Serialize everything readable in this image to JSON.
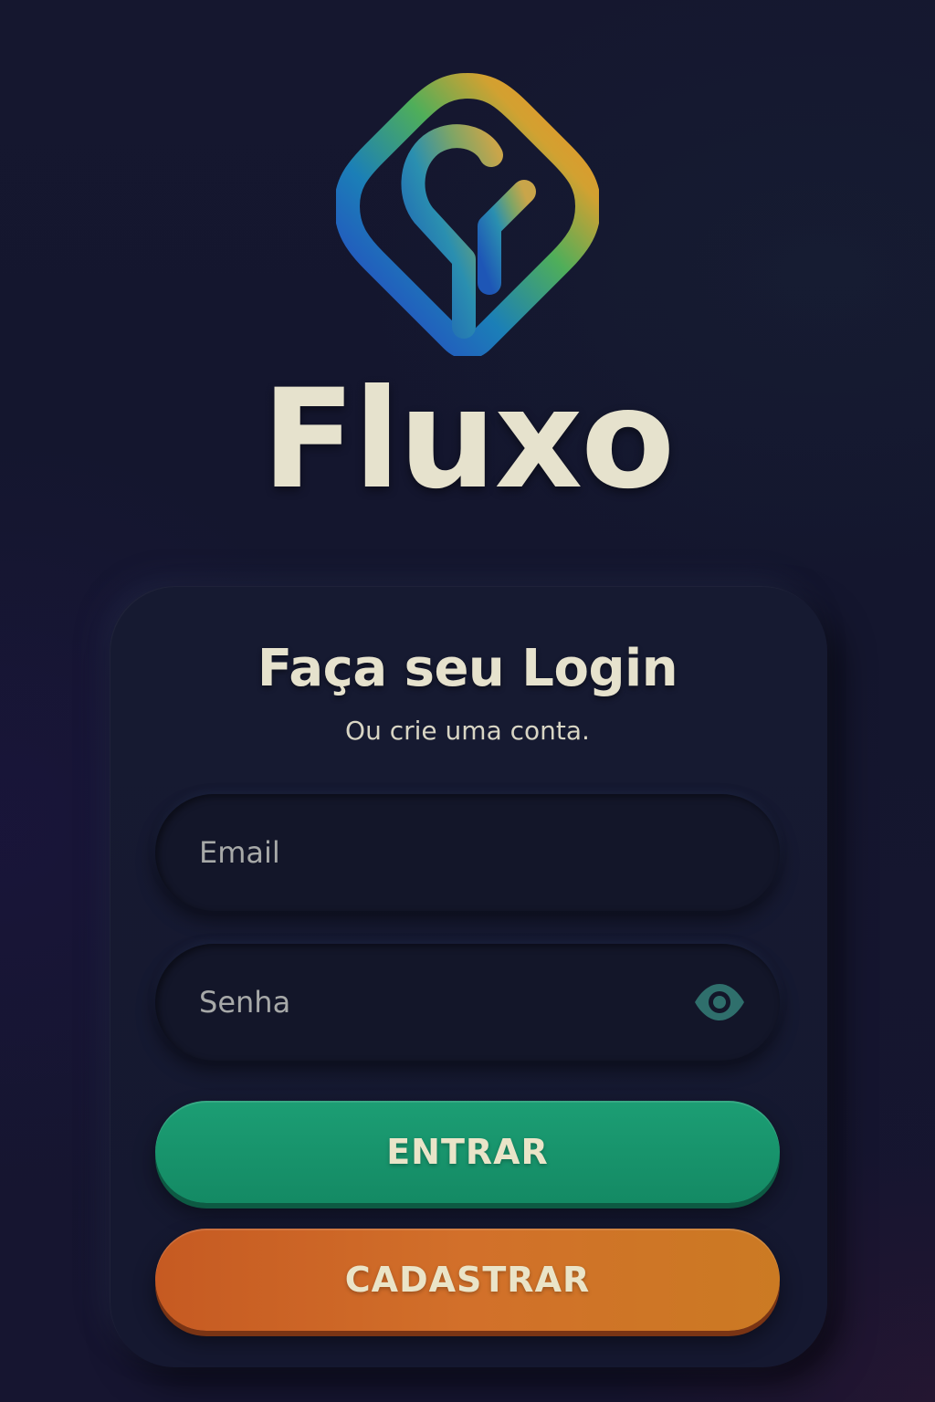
{
  "brand": {
    "logo_icon": "fluxo-logo-icon",
    "name": "Fluxo"
  },
  "login": {
    "title": "Faça seu Login",
    "subtitle": "Ou crie uma conta.",
    "email": {
      "placeholder": "Email",
      "value": ""
    },
    "password": {
      "placeholder": "Senha",
      "value": "",
      "toggle_icon": "eye-icon"
    },
    "login_button_label": "ENTRAR",
    "signup_button_label": "CADASTRAR"
  },
  "colors": {
    "background": "#15172f",
    "card": "#161a31",
    "text": "#e6e2cd",
    "login_button": "#1c9e74",
    "signup_button": "#d2702a",
    "eye_icon": "#2f6f6c"
  }
}
